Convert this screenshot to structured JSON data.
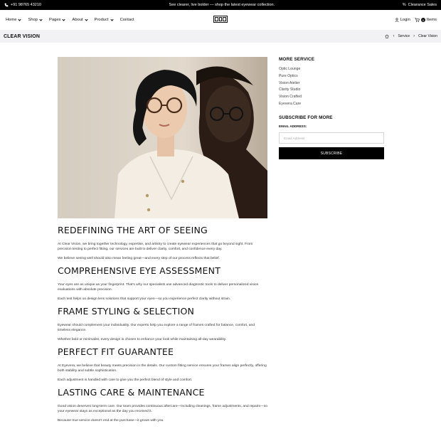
{
  "topbar": {
    "phone": "+91 98765 43210",
    "promo": "See clearer, live bolder — shop the latest eyewear collection.",
    "sale": "Clearance Sales"
  },
  "nav": {
    "items": [
      {
        "label": "Home"
      },
      {
        "label": "Shop"
      },
      {
        "label": "Pages"
      },
      {
        "label": "About"
      },
      {
        "label": "Product"
      },
      {
        "label": "Contact"
      }
    ],
    "login": "Login",
    "cart_count": "0",
    "cart_label": "Items"
  },
  "page": {
    "title": "CLEAR VISION"
  },
  "breadcrumb": {
    "items": [
      "Service",
      "Clear Vision"
    ]
  },
  "sections": [
    {
      "heading": "REDEFINING THE ART OF SEEING",
      "p1": "At Clear Vision, we bring together technology, expertise, and artistry to create eyewear experiences that go beyond sight. From precision testing to perfect fitting, our services are built to deliver clarity, comfort, and confidence every day.",
      "p2": "We believe seeing well should also mean feeling great—and every step of our process reflects that belief."
    },
    {
      "heading": "COMPREHENSIVE EYE ASSESSMENT",
      "p1": "Your eyes are as unique as your fingerprint. That's why our specialists use advanced diagnostic tools to deliver personalized vision evaluations with absolute precision.",
      "p2": "Each test helps us design lens solutions that support your eyes—so you experience perfect clarity without strain."
    },
    {
      "heading": "FRAME STYLING & SELECTION",
      "p1": "Eyewear should complement your individuality. Our experts help you explore a range of frames crafted for balance, comfort, and timeless elegance.",
      "p2": "Whether bold or minimalist, every design is chosen to enhance your look while maintaining all-day wearability."
    },
    {
      "heading": "PERFECT FIT GUARANTEE",
      "p1": "At Eyevera, we believe that beauty meets precision in the details. Our custom fitting service ensures your frames align perfectly, offering both stability and subtle sophistication.",
      "p2": "Each adjustment is handled with care to give you the perfect blend of style and comfort."
    },
    {
      "heading": "LASTING CARE & MAINTENANCE",
      "p1": "Good vision deserves long-term care. Our team provides continuous aftercare—including cleanings, frame adjustments, and repairs—so your eyewear stays as exceptional as the day you received it.",
      "p2": "Because true service doesn't end at the purchase—it grows with you."
    }
  ],
  "sidebar": {
    "more_title": "MORE SERVICE",
    "services": [
      "Optic Lounge",
      "Pure Optics",
      "Vision Atelier",
      "Clarity Studio",
      "Vision Crafted",
      "Eyevera Care"
    ],
    "subscribe_title": "SUBSCRIBE FOR MORE",
    "email_label": "EMAIL ADDRESS:",
    "email_placeholder": "Email Address",
    "subscribe_button": "SUBSCRIBE"
  }
}
